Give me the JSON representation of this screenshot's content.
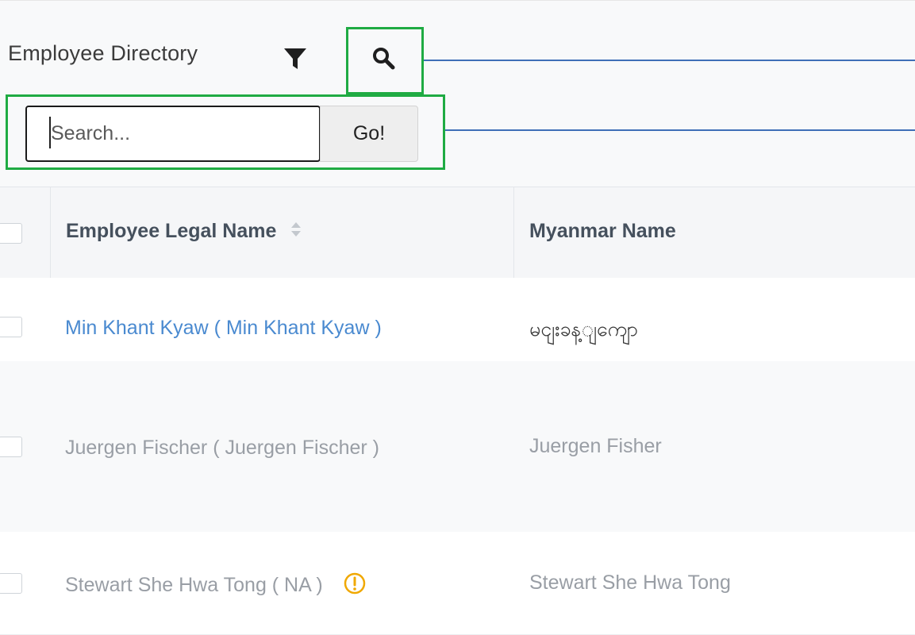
{
  "header": {
    "title": "Employee Directory",
    "filter_icon": "filter-icon",
    "search_icon": "search-icon"
  },
  "search": {
    "placeholder": "Search...",
    "value": "",
    "go_label": "Go!"
  },
  "table": {
    "columns": [
      "Employee Legal Name",
      "Myanmar Name"
    ],
    "rows": [
      {
        "legal_name": "Min Khant Kyaw ( Min Khant Kyaw )",
        "myanmar_name": "မငျးခန့ျကျော",
        "style": "link",
        "warning": false
      },
      {
        "legal_name": "Juergen Fischer ( Juergen Fischer )",
        "myanmar_name": "Juergen Fisher",
        "style": "muted",
        "warning": false
      },
      {
        "legal_name": "Stewart She Hwa Tong ( NA )",
        "myanmar_name": "Stewart She Hwa Tong",
        "style": "muted",
        "warning": true
      }
    ]
  },
  "colors": {
    "callout_box": "#1fab43",
    "callout_line": "#3f6fb7",
    "link": "#4a8ad0",
    "warning": "#f0a800"
  }
}
